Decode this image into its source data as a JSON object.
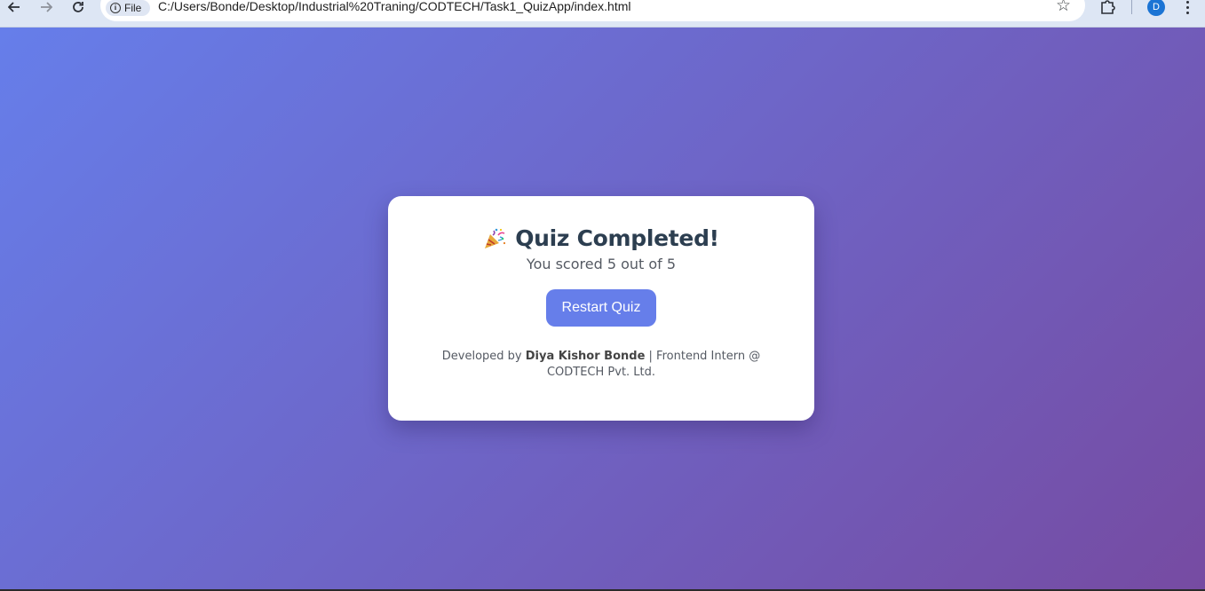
{
  "browser": {
    "site_chip_label": "File",
    "url": "C:/Users/Bonde/Desktop/Industrial%20Traning/CODTECH/Task1_QuizApp/index.html",
    "profile_initial": "D",
    "icons": [
      "back-arrow-icon",
      "forward-arrow-icon",
      "reload-icon",
      "info-icon",
      "star-icon",
      "extensions-icon",
      "menu-icon"
    ]
  },
  "quiz": {
    "title": "Quiz Completed!",
    "score_text": "You scored 5 out of 5",
    "restart_label": "Restart Quiz"
  },
  "footer": {
    "prefix": "Developed by",
    "author": "Diya Kishor Bonde",
    "suffix": "| Frontend Intern @ CODTECH Pvt. Ltd."
  },
  "colors": {
    "gradient_start": "#667eea",
    "gradient_end": "#764ba2",
    "button": "#667eea",
    "title": "#2c3e50"
  }
}
